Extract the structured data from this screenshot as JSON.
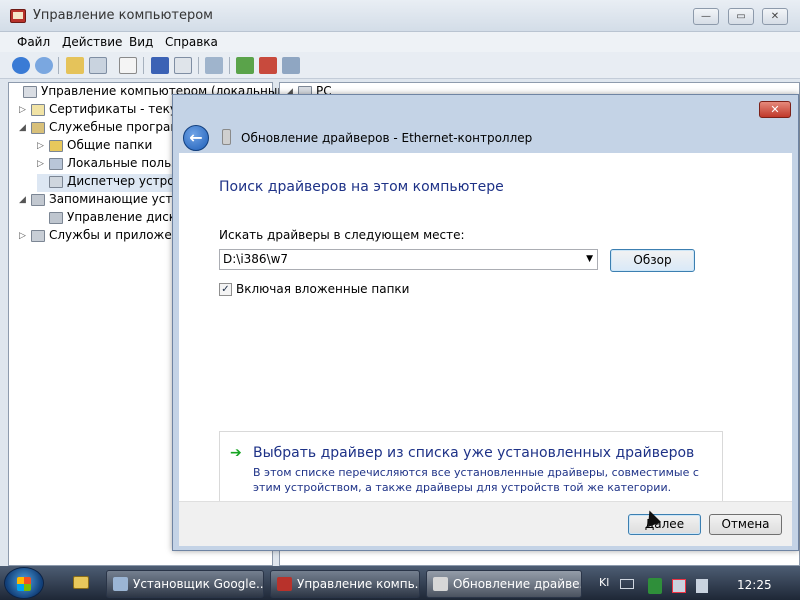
{
  "mmc": {
    "title": "Управление компьютером",
    "window_buttons": {
      "minimize": "—",
      "maximize": "▭",
      "close": "✕"
    },
    "menu": [
      "Файл",
      "Действие",
      "Вид",
      "Справка"
    ],
    "tree": [
      {
        "label": "Управление компьютером (локальным)",
        "twisty": "",
        "icon": "computer-management-icon"
      },
      {
        "label": "Сертификаты - текущ",
        "twisty": "▷",
        "icon": "certificates-icon"
      },
      {
        "label": "Служебные программ",
        "twisty": "◢",
        "icon": "system-tools-icon"
      },
      {
        "label": "Общие папки",
        "twisty": "▷",
        "icon": "shared-folders-icon"
      },
      {
        "label": "Локальные пользо",
        "twisty": "▷",
        "icon": "local-users-icon"
      },
      {
        "label": "Диспетчер устрой",
        "twisty": "",
        "icon": "device-manager-icon"
      },
      {
        "label": "Запоминающие устр",
        "twisty": "◢",
        "icon": "storage-icon"
      },
      {
        "label": "Управление диска",
        "twisty": "",
        "icon": "disk-management-icon"
      },
      {
        "label": "Службы и приложен",
        "twisty": "▷",
        "icon": "services-icon"
      }
    ],
    "right_pane_first_item": "PC"
  },
  "wizard": {
    "title": "Обновление драйверов - Ethernet-контроллер",
    "close_label": "✕",
    "back_label": "←",
    "heading": "Поиск драйверов на этом компьютере",
    "search_label": "Искать драйверы в следующем месте:",
    "path_value": "D:\\i386\\w7",
    "browse_label": "Обзор",
    "include_subfolders_label": "Включая вложенные папки",
    "include_subfolders_checked": true,
    "check_mark": "✓",
    "pick_link_title": "Выбрать драйвер из списка уже установленных драйверов",
    "pick_link_desc": "В этом списке перечисляются все установленные драйверы, совместимые с этим устройством, а также драйверы для устройств той же категории.",
    "next_label": "Далее",
    "cancel_label": "Отмена"
  },
  "taskbar": {
    "tasks": [
      {
        "label": "Установщик Google...",
        "active": false
      },
      {
        "label": "Управление компь...",
        "active": false
      },
      {
        "label": "Обновление драйве...",
        "active": true
      }
    ],
    "tray_lang": "Kl",
    "clock": "12:25"
  },
  "colors": {
    "link_blue": "#1e3287",
    "arrow_green": "#17a523",
    "close_red": "#c0382a"
  }
}
